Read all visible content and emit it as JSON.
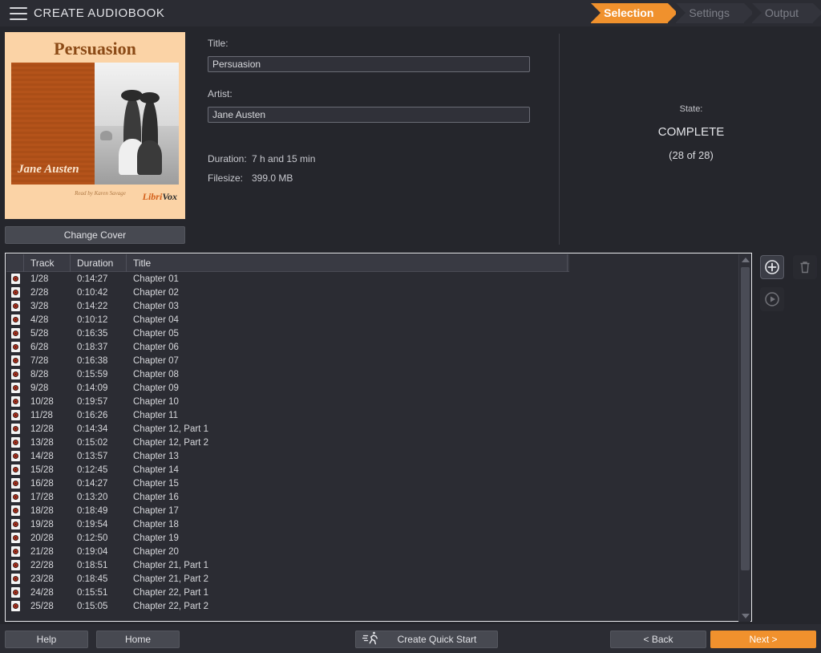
{
  "app": {
    "title": "CREATE AUDIOBOOK",
    "menu_icon": "hamburger-icon"
  },
  "steps": [
    {
      "label": "Selection",
      "active": true
    },
    {
      "label": "Settings",
      "active": false
    },
    {
      "label": "Output",
      "active": false
    }
  ],
  "cover": {
    "title": "Persuasion",
    "author": "Jane Austen",
    "read_by": "Read by\nKaren Savage",
    "logo_part1": "Libri",
    "logo_part2": "Vox",
    "change_button": "Change Cover"
  },
  "meta": {
    "title_label": "Title:",
    "title_value": "Persuasion",
    "title_placeholder": "Title",
    "artist_label": "Artist:",
    "artist_value": "Jane Austen",
    "artist_placeholder": "Artist",
    "duration_label": "Duration:",
    "duration_value": "7 h and 15 min",
    "filesize_label": "Filesize:",
    "filesize_value": "399.0 MB"
  },
  "state": {
    "label": "State:",
    "value": "COMPLETE",
    "count": "(28 of 28)"
  },
  "tracks": {
    "columns": [
      "",
      "Track",
      "Duration",
      "Title"
    ],
    "rows": [
      {
        "icon": "disc-icon",
        "track": "1/28",
        "duration": "0:14:27",
        "title": "Chapter 01"
      },
      {
        "icon": "disc-icon",
        "track": "2/28",
        "duration": "0:10:42",
        "title": "Chapter 02"
      },
      {
        "icon": "disc-icon",
        "track": "3/28",
        "duration": "0:14:22",
        "title": "Chapter 03"
      },
      {
        "icon": "disc-icon",
        "track": "4/28",
        "duration": "0:10:12",
        "title": "Chapter 04"
      },
      {
        "icon": "disc-icon",
        "track": "5/28",
        "duration": "0:16:35",
        "title": "Chapter 05"
      },
      {
        "icon": "disc-icon",
        "track": "6/28",
        "duration": "0:18:37",
        "title": "Chapter 06"
      },
      {
        "icon": "disc-icon",
        "track": "7/28",
        "duration": "0:16:38",
        "title": "Chapter 07"
      },
      {
        "icon": "disc-icon",
        "track": "8/28",
        "duration": "0:15:59",
        "title": "Chapter 08"
      },
      {
        "icon": "disc-icon",
        "track": "9/28",
        "duration": "0:14:09",
        "title": "Chapter 09"
      },
      {
        "icon": "disc-icon",
        "track": "10/28",
        "duration": "0:19:57",
        "title": "Chapter 10"
      },
      {
        "icon": "disc-icon",
        "track": "11/28",
        "duration": "0:16:26",
        "title": "Chapter 11"
      },
      {
        "icon": "disc-icon",
        "track": "12/28",
        "duration": "0:14:34",
        "title": "Chapter 12, Part 1"
      },
      {
        "icon": "disc-icon",
        "track": "13/28",
        "duration": "0:15:02",
        "title": "Chapter 12, Part 2"
      },
      {
        "icon": "disc-icon",
        "track": "14/28",
        "duration": "0:13:57",
        "title": "Chapter 13"
      },
      {
        "icon": "disc-icon",
        "track": "15/28",
        "duration": "0:12:45",
        "title": "Chapter 14"
      },
      {
        "icon": "disc-icon",
        "track": "16/28",
        "duration": "0:14:27",
        "title": "Chapter 15"
      },
      {
        "icon": "disc-icon",
        "track": "17/28",
        "duration": "0:13:20",
        "title": "Chapter 16"
      },
      {
        "icon": "disc-icon",
        "track": "18/28",
        "duration": "0:18:49",
        "title": "Chapter 17"
      },
      {
        "icon": "disc-icon",
        "track": "19/28",
        "duration": "0:19:54",
        "title": "Chapter 18"
      },
      {
        "icon": "disc-icon",
        "track": "20/28",
        "duration": "0:12:50",
        "title": "Chapter 19"
      },
      {
        "icon": "disc-icon",
        "track": "21/28",
        "duration": "0:19:04",
        "title": "Chapter 20"
      },
      {
        "icon": "disc-icon",
        "track": "22/28",
        "duration": "0:18:51",
        "title": "Chapter 21, Part 1"
      },
      {
        "icon": "disc-icon",
        "track": "23/28",
        "duration": "0:18:45",
        "title": "Chapter 21, Part 2"
      },
      {
        "icon": "disc-icon",
        "track": "24/28",
        "duration": "0:15:51",
        "title": "Chapter 22, Part 1"
      },
      {
        "icon": "disc-icon",
        "track": "25/28",
        "duration": "0:15:05",
        "title": "Chapter 22, Part 2"
      }
    ]
  },
  "side_buttons": [
    {
      "name": "add-track-button",
      "icon": "plus-circle-icon",
      "enabled": true
    },
    {
      "name": "delete-track-button",
      "icon": "trash-icon",
      "enabled": false
    },
    {
      "name": "play-track-button",
      "icon": "play-circle-icon",
      "enabled": false
    }
  ],
  "bottom": {
    "help": "Help",
    "home": "Home",
    "quick_start": "Create Quick Start",
    "quick_start_icon": "runner-icon",
    "back": "< Back",
    "next": "Next >"
  },
  "colors": {
    "accent": "#f0912d",
    "background": "#25262c",
    "panel": "#2b2c33",
    "cover_bg": "#fbd3a6"
  }
}
